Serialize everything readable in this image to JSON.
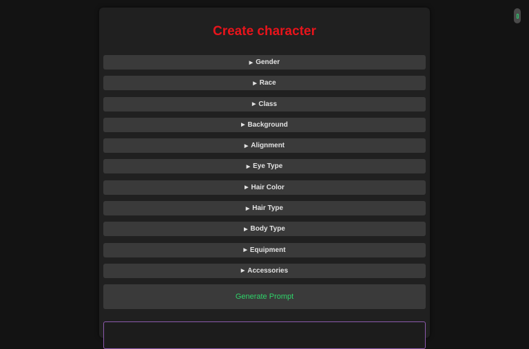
{
  "title": "Create character",
  "sections": [
    {
      "label": "Gender"
    },
    {
      "label": "Race"
    },
    {
      "label": "Class"
    },
    {
      "label": "Background"
    },
    {
      "label": "Alignment"
    },
    {
      "label": "Eye Type"
    },
    {
      "label": "Hair Color"
    },
    {
      "label": "Hair Type"
    },
    {
      "label": "Body Type"
    },
    {
      "label": "Equipment"
    },
    {
      "label": "Accessories"
    }
  ],
  "disclosure_marker": "▶",
  "generate_label": "Generate Prompt",
  "colors": {
    "title": "#e8141b",
    "generate_text": "#2fd46a",
    "output_border": "#8e5bb0",
    "section_bg": "#3a3a3a",
    "panel_bg": "#202020",
    "page_bg": "#131313"
  }
}
